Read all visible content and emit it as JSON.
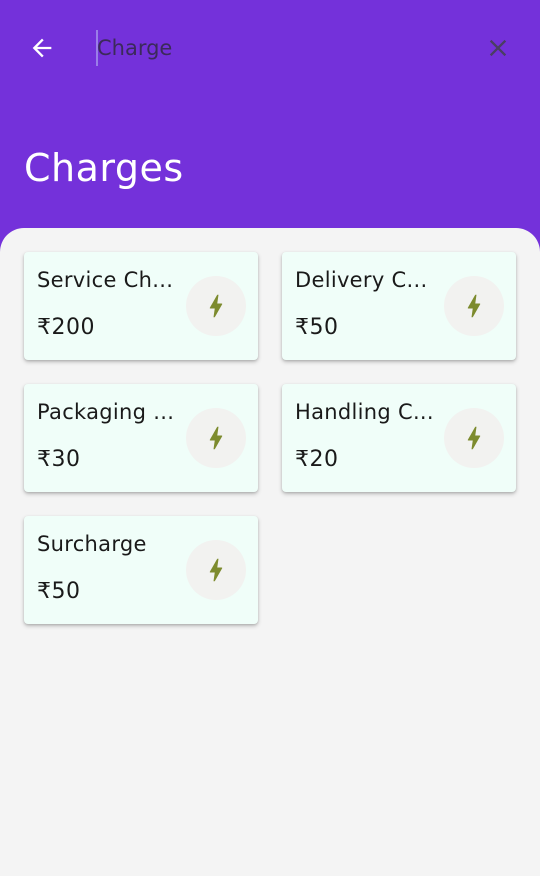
{
  "search": {
    "value": "Charge",
    "placeholder": ""
  },
  "header": {
    "title": "Charges"
  },
  "colors": {
    "primary": "#7431da",
    "card_bg": "#f0fef9",
    "icon": "#7d8b2e",
    "surface": "#f4f4f4"
  },
  "icons": {
    "back": "arrow-left-icon",
    "clear": "close-icon",
    "charge": "bolt-icon"
  },
  "charges": [
    {
      "name": "Service Ch...",
      "amount": "₹200"
    },
    {
      "name": "Delivery C...",
      "amount": "₹50"
    },
    {
      "name": "Packaging ...",
      "amount": "₹30"
    },
    {
      "name": "Handling C...",
      "amount": "₹20"
    },
    {
      "name": "Surcharge",
      "amount": "₹50"
    }
  ]
}
